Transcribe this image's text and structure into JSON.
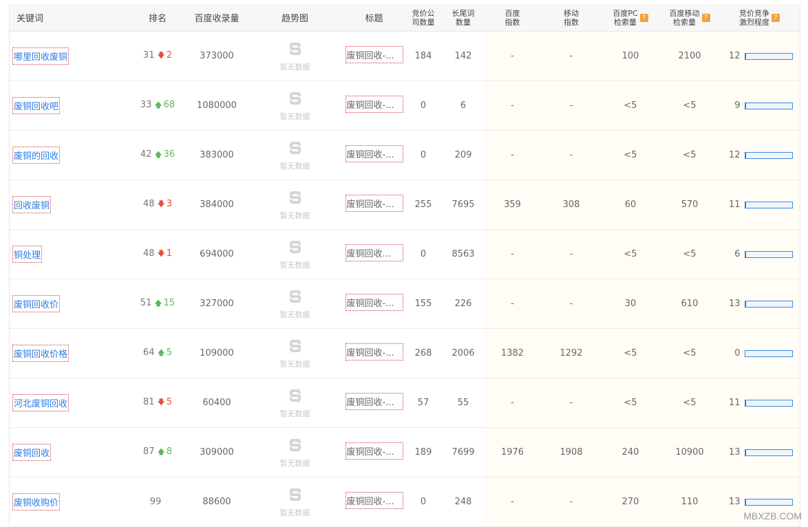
{
  "headers": {
    "keyword": "关键词",
    "rank": "排名",
    "indexed": "百度收录量",
    "trend": "趋势图",
    "title": "标题",
    "bid_companies": [
      "竞价公",
      "司数量"
    ],
    "long_tail": [
      "长尾词",
      "数量"
    ],
    "baidu_index": [
      "百度",
      "指数"
    ],
    "mobile_index": [
      "移动",
      "指数"
    ],
    "pc_search": [
      "百度PC",
      "检索量"
    ],
    "mobile_search": [
      "百度移动",
      "检索量"
    ],
    "competition": [
      "竞价竞争",
      "激烈程度"
    ],
    "help_mark": "?"
  },
  "trend_placeholder": "暂无数据",
  "colors": {
    "link": "#2c7be5",
    "down": "#e74c3c",
    "up": "#5cb85c",
    "bar": "#1e6fd9",
    "help": "#f2a33a"
  },
  "rows": [
    {
      "keyword": "哪里回收废铜",
      "rank": "31",
      "change_dir": "down",
      "change_arrow": "🡇",
      "change": "2",
      "indexed": "373000",
      "title": "废铜回收-...",
      "bid_companies": "184",
      "long_tail": "142",
      "baidu_index": "-",
      "mobile_index": "-",
      "pc_search": "100",
      "mobile_search": "2100",
      "competition": "12"
    },
    {
      "keyword": "废铜回收吧",
      "rank": "33",
      "change_dir": "up",
      "change_arrow": "🡅",
      "change": "68",
      "indexed": "1080000",
      "title": "废铜回收-...",
      "bid_companies": "0",
      "long_tail": "6",
      "baidu_index": "-",
      "mobile_index": "-",
      "pc_search": "<5",
      "mobile_search": "<5",
      "competition": "9"
    },
    {
      "keyword": "废铜的回收",
      "rank": "42",
      "change_dir": "up",
      "change_arrow": "🡅",
      "change": "36",
      "indexed": "383000",
      "title": "废铜回收-...",
      "bid_companies": "0",
      "long_tail": "209",
      "baidu_index": "-",
      "mobile_index": "-",
      "pc_search": "<5",
      "mobile_search": "<5",
      "competition": "12"
    },
    {
      "keyword": "回收废铜",
      "rank": "48",
      "change_dir": "down",
      "change_arrow": "🡇",
      "change": "3",
      "indexed": "384000",
      "title": "废铜回收-...",
      "bid_companies": "255",
      "long_tail": "7695",
      "baidu_index": "359",
      "mobile_index": "308",
      "pc_search": "60",
      "mobile_search": "570",
      "competition": "11"
    },
    {
      "keyword": "铜处理",
      "rank": "48",
      "change_dir": "down",
      "change_arrow": "🡇",
      "change": "1",
      "indexed": "694000",
      "title": "废铜回收...",
      "bid_companies": "0",
      "long_tail": "8563",
      "baidu_index": "-",
      "mobile_index": "-",
      "pc_search": "<5",
      "mobile_search": "<5",
      "competition": "6"
    },
    {
      "keyword": "废铜回收价",
      "rank": "51",
      "change_dir": "up",
      "change_arrow": "🡅",
      "change": "15",
      "indexed": "327000",
      "title": "废铜回收-...",
      "bid_companies": "155",
      "long_tail": "226",
      "baidu_index": "-",
      "mobile_index": "-",
      "pc_search": "30",
      "mobile_search": "610",
      "competition": "13"
    },
    {
      "keyword": "废铜回收价格",
      "rank": "64",
      "change_dir": "up",
      "change_arrow": "🡅",
      "change": "5",
      "indexed": "109000",
      "title": "废铜回收-...",
      "bid_companies": "268",
      "long_tail": "2006",
      "baidu_index": "1382",
      "mobile_index": "1292",
      "pc_search": "<5",
      "mobile_search": "<5",
      "competition": "0"
    },
    {
      "keyword": "河北废铜回收",
      "rank": "81",
      "change_dir": "down",
      "change_arrow": "🡇",
      "change": "5",
      "indexed": "60400",
      "title": "废铜回收-...",
      "bid_companies": "57",
      "long_tail": "55",
      "baidu_index": "-",
      "mobile_index": "-",
      "pc_search": "<5",
      "mobile_search": "<5",
      "competition": "11"
    },
    {
      "keyword": "废铜回收",
      "rank": "87",
      "change_dir": "up",
      "change_arrow": "🡅",
      "change": "8",
      "indexed": "309000",
      "title": "废铜回收-...",
      "bid_companies": "189",
      "long_tail": "7699",
      "baidu_index": "1976",
      "mobile_index": "1908",
      "pc_search": "240",
      "mobile_search": "10900",
      "competition": "13"
    },
    {
      "keyword": "废铜收购价",
      "rank": "99",
      "change_dir": "",
      "change_arrow": "",
      "change": "",
      "indexed": "88600",
      "title": "废铜回收-...",
      "bid_companies": "0",
      "long_tail": "248",
      "baidu_index": "-",
      "mobile_index": "-",
      "pc_search": "270",
      "mobile_search": "110",
      "competition": "13"
    }
  ],
  "watermark": "MBXZB.COM"
}
